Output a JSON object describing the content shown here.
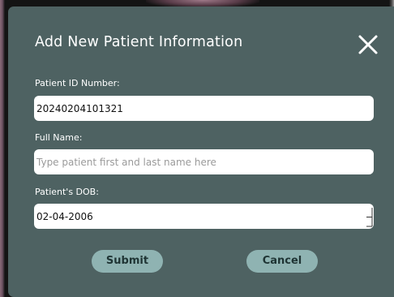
{
  "modal": {
    "title": "Add New Patient Information",
    "close_icon": "close-icon"
  },
  "form": {
    "patient_id": {
      "label": "Patient ID Number:",
      "value": "20240204101321"
    },
    "full_name": {
      "label": "Full Name:",
      "value": "",
      "placeholder": "Type patient first and last name here"
    },
    "dob": {
      "label": "Patient's DOB:",
      "value": "02-04-2006"
    }
  },
  "actions": {
    "submit_label": "Submit",
    "cancel_label": "Cancel"
  },
  "colors": {
    "modal_bg": "#4e6262",
    "button_bg": "#8fb3b2",
    "button_text": "#1f3434",
    "field_bg": "#ffffff"
  }
}
